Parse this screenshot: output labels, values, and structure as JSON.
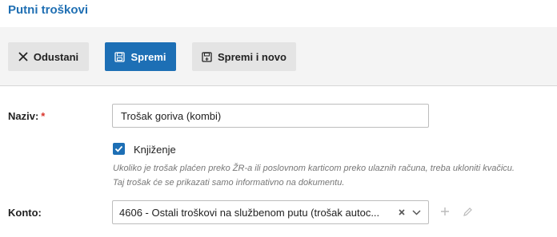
{
  "header": {
    "title": "Putni troškovi"
  },
  "toolbar": {
    "cancel_label": "Odustani",
    "save_label": "Spremi",
    "save_new_label": "Spremi i novo"
  },
  "form": {
    "naziv": {
      "label": "Naziv:",
      "required_mark": "*",
      "value": "Trošak goriva (kombi)"
    },
    "knjizenje": {
      "label": "Knjiženje",
      "checked": true,
      "hint_line1": "Ukoliko je trošak plaćen preko ŽR-a ili poslovnom karticom preko ulaznih računa, treba ukloniti kvačicu.",
      "hint_line2": "Taj trošak će se prikazati samo informativno na dokumentu."
    },
    "konto": {
      "label": "Konto:",
      "value": "4606 - Ostali troškovi na službenom putu (trošak autoc..."
    }
  },
  "colors": {
    "accent": "#1d6fb5",
    "title": "#1f6fb3",
    "required": "#d9342b"
  },
  "icons": {
    "cancel": "close-icon",
    "save": "floppy-disk-icon",
    "save_new": "floppy-disk-plus-icon",
    "clear": "clear-x-icon",
    "dropdown": "chevron-down-icon",
    "add": "plus-icon",
    "edit": "pencil-icon"
  }
}
